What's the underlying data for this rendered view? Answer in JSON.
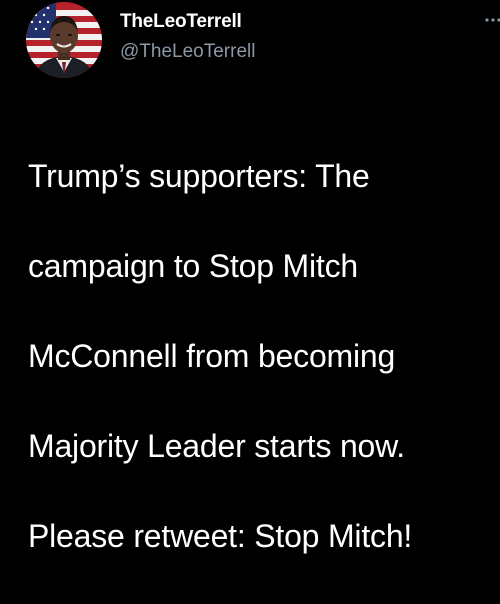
{
  "tweet": {
    "author": {
      "display_name": "TheLeoTerrell",
      "handle": "@TheLeoTerrell",
      "avatar_icon": "profile-photo-with-flag"
    },
    "menu_icon": "more-options-icon",
    "text_lines": [
      "Trump’s supporters: The",
      "campaign to Stop Mitch",
      "McConnell from becoming",
      "Majority Leader starts now.",
      "Please retweet:  Stop Mitch!"
    ]
  },
  "colors": {
    "background": "#000000",
    "primary_text": "#ffffff",
    "secondary_text": "#8b98a5"
  }
}
